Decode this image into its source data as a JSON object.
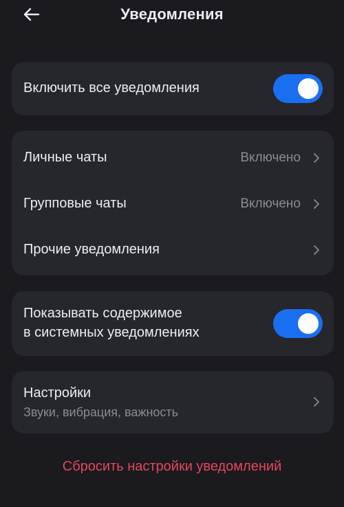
{
  "header": {
    "back_icon": "arrow-left-icon",
    "title": "Уведомления"
  },
  "master_toggle": {
    "label": "Включить все уведомления",
    "on": true
  },
  "categories": {
    "items": [
      {
        "label": "Личные чаты",
        "value": "Включено"
      },
      {
        "label": "Групповые чаты",
        "value": "Включено"
      },
      {
        "label": "Прочие уведомления",
        "value": ""
      }
    ]
  },
  "show_content": {
    "label_line1": "Показывать содержимое",
    "label_line2": "в системных уведомлениях",
    "on": true
  },
  "settings": {
    "label": "Настройки",
    "sublabel": "Звуки, вибрация, важность"
  },
  "reset": {
    "label": "Сбросить настройки уведомлений"
  },
  "colors": {
    "background": "#1a1a1f",
    "card": "#26262d",
    "toggle_on": "#1a6ff1",
    "danger": "#e5475a",
    "secondary_text": "#8a8b93"
  }
}
